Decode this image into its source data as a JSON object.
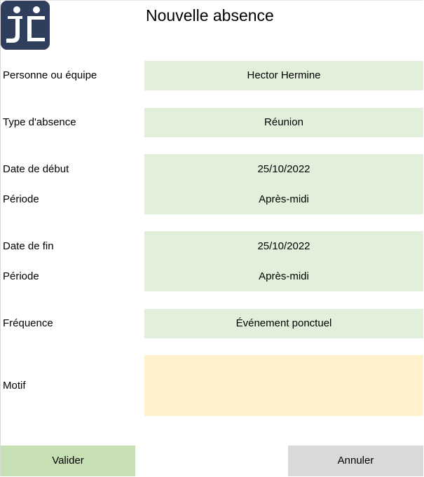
{
  "window": {
    "title": "Nouvelle absence"
  },
  "colors": {
    "field_bg": "#e2efda",
    "motif_bg": "#fff2cc",
    "valider_bg": "#c6e0b4",
    "annuler_bg": "#d9d9d9",
    "logo_bg": "#2f3e5c"
  },
  "logo": {
    "icon": "jc-logo-icon"
  },
  "form": {
    "personne": {
      "label": "Personne ou équipe",
      "value": "Hector Hermine"
    },
    "type_absence": {
      "label": "Type d'absence",
      "value": "Réunion"
    },
    "date_debut": {
      "label": "Date de début",
      "value": "25/10/2022"
    },
    "periode_debut": {
      "label": "Période",
      "value": "Après-midi"
    },
    "date_fin": {
      "label": "Date de fin",
      "value": "25/10/2022"
    },
    "periode_fin": {
      "label": "Période",
      "value": "Après-midi"
    },
    "frequence": {
      "label": "Fréquence",
      "value": "Événement ponctuel"
    },
    "motif": {
      "label": "Motif",
      "value": ""
    }
  },
  "buttons": {
    "valider": "Valider",
    "annuler": "Annuler"
  }
}
